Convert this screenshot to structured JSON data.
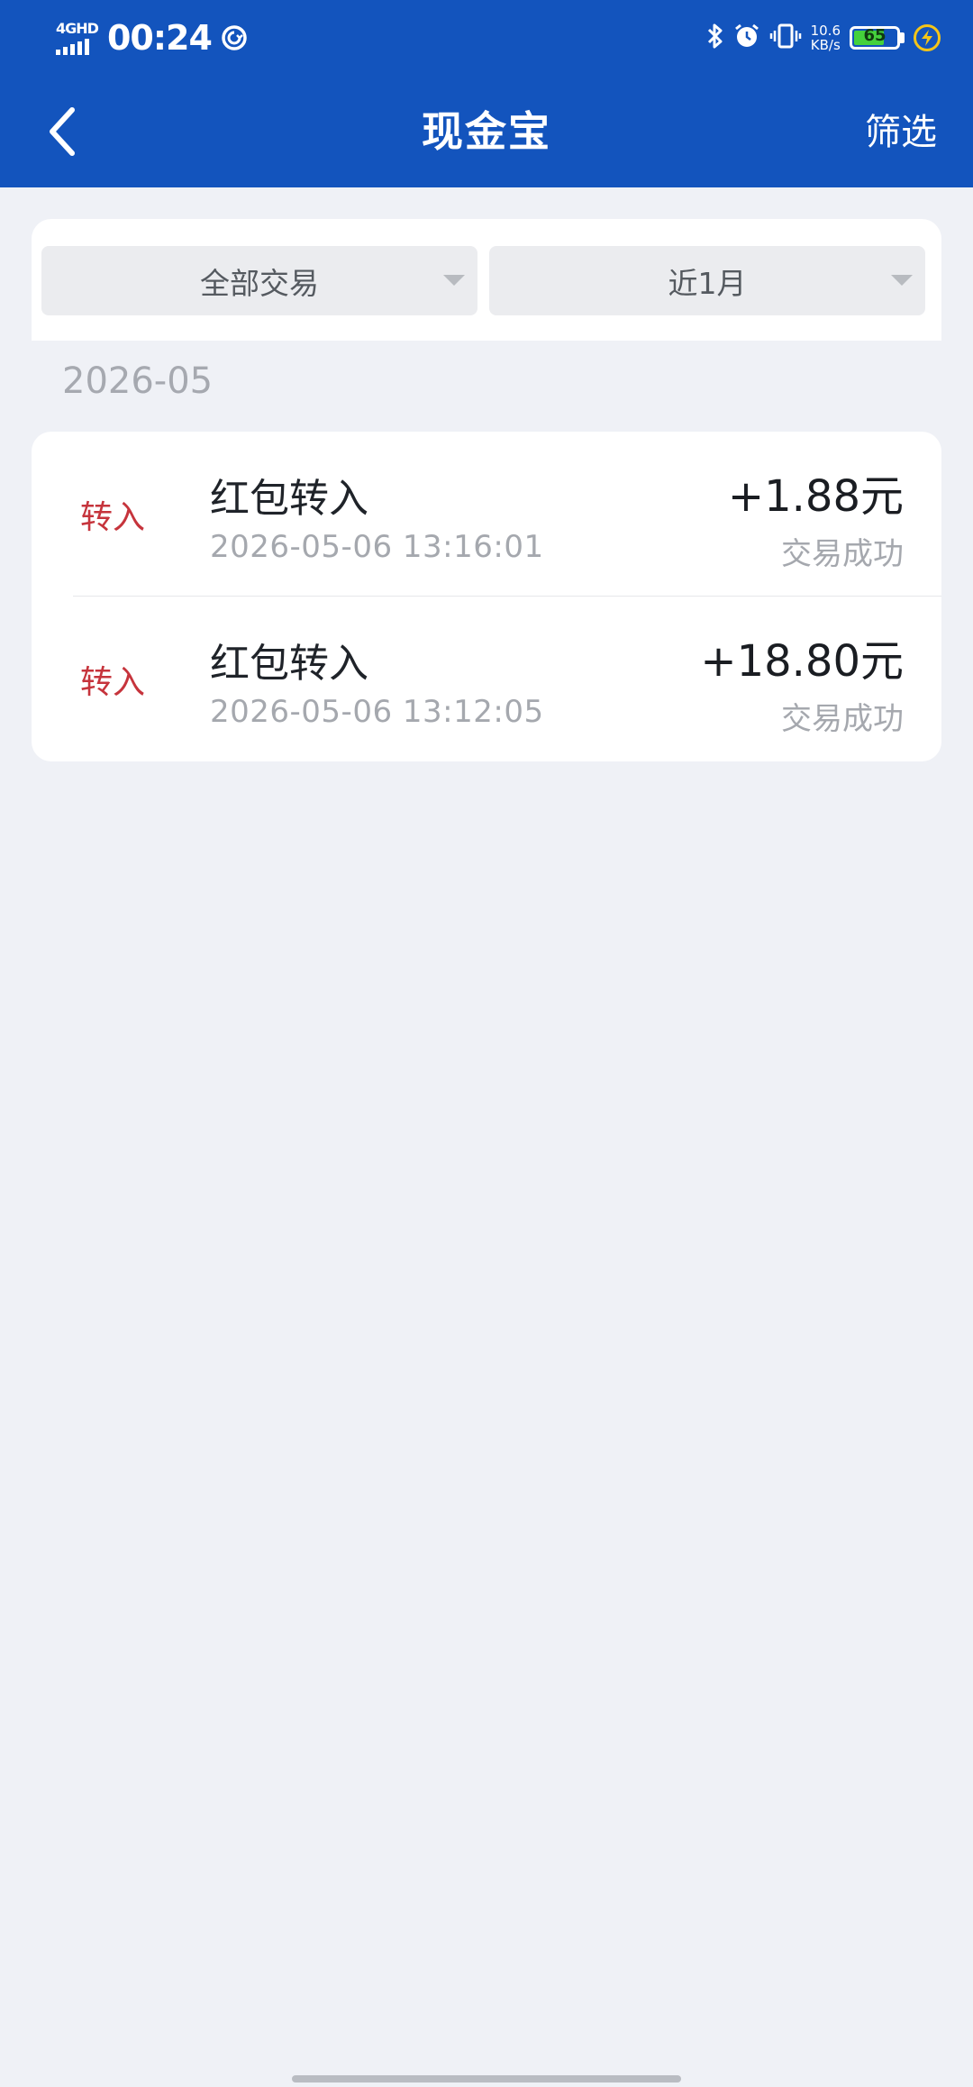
{
  "status_bar": {
    "network": "4GHD",
    "time": "00:24",
    "speed_value": "10.6",
    "speed_unit": "KB/s",
    "battery_level": "65"
  },
  "nav": {
    "title": "现金宝",
    "filter_label": "筛选"
  },
  "filters": {
    "type": "全部交易",
    "period": "近1月"
  },
  "month": "2026-05",
  "transactions": [
    {
      "tag": "转入",
      "title": "红包转入",
      "time": "2026-05-06 13:16:01",
      "amount": "+1.88元",
      "status": "交易成功"
    },
    {
      "tag": "转入",
      "title": "红包转入",
      "time": "2026-05-06 13:12:05",
      "amount": "+18.80元",
      "status": "交易成功"
    }
  ],
  "colors": {
    "header": "#1354bd",
    "page_bg": "#eff1f6",
    "tag_red": "#c6343c",
    "muted_text": "#a5a8ae",
    "battery_green": "#45d13c",
    "charge_yellow": "#f5c518"
  }
}
